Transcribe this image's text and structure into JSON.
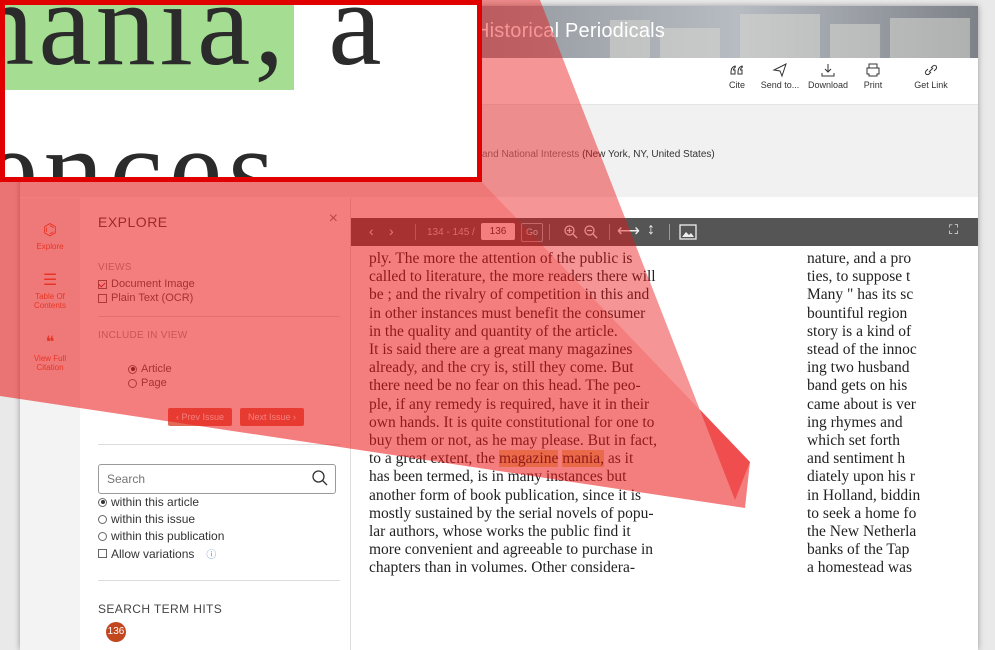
{
  "header": {
    "title": "Historical Periodicals"
  },
  "toolbar": {
    "cite": "Cite",
    "send_to": "Send to...",
    "download": "Download",
    "print": "Print",
    "get_link": "Get Link"
  },
  "meta": {
    "source_prefix": "and National Interests",
    "location": "(New York, NY, United States)"
  },
  "rail": {
    "explore": "Explore",
    "toc": "Table Of Contents",
    "citation": "View Full Citation"
  },
  "explore": {
    "title": "EXPLORE",
    "close": "×",
    "views_label": "VIEWS",
    "view_document_image": "Document Image",
    "view_plain_text": "Plain Text (OCR)",
    "include_label": "INCLUDE IN VIEW",
    "include_article": "Article",
    "include_page": "Page",
    "prev_issue": "‹ Prev Issue",
    "next_issue": "Next Issue ›",
    "search_placeholder": "Search",
    "scope_article": "within this article",
    "scope_issue": "within this issue",
    "scope_publication": "within this publication",
    "allow_variations": "Allow variations",
    "hits_label": "SEARCH TERM HITS",
    "hits_count": "136"
  },
  "viewer": {
    "page_range": "134 - 145 /",
    "page_number": "136",
    "go": "Go",
    "column1": [
      "ply.  The more the attention of the public is",
      "called to literature, the more readers there will",
      "be ; and the rivalry of competition in this and",
      "in other instances must benefit the consumer",
      "in the quality and quantity of the article.",
      "It is said there are a great many magazines",
      "already, and the cry is, still they come.  But",
      "there need be no fear on this head.  The peo-",
      "ple, if any remedy is required, have it in their",
      "own hands.  It is quite constitutional for one to",
      "buy them or not, as he may please.  But in fact,",
      "to a great extent, the ",
      "has been termed, is in many instances but",
      "another form of book publication, since it is",
      "mostly sustained by the serial novels of popu-",
      "lar authors, whose works the public find it",
      "more convenient and agreeable to purchase in",
      "chapters than in volumes.  Other considera-"
    ],
    "hl_word1": "magazine",
    "hl_word2": "mania,",
    "line12_tail": " as it",
    "column2": [
      "nature, and a pro",
      "ties, to suppose  t",
      "Many \" has its sc",
      "bountiful  region",
      "story is a kind of",
      "stead of the innoc",
      "ing two husband",
      "band gets on his",
      "came about is ver",
      "ing  rhymes  and",
      "which  set  forth",
      "and  sentiment  h",
      "diately upon his r",
      "in Holland, biddin",
      "to seek a home fo",
      "the New Netherla",
      "banks of the Tap",
      "a homestead was"
    ]
  },
  "zoom": {
    "line1_pre": "",
    "line1_hl": "mania,",
    "line1_post": " a",
    "line2": "tences"
  }
}
